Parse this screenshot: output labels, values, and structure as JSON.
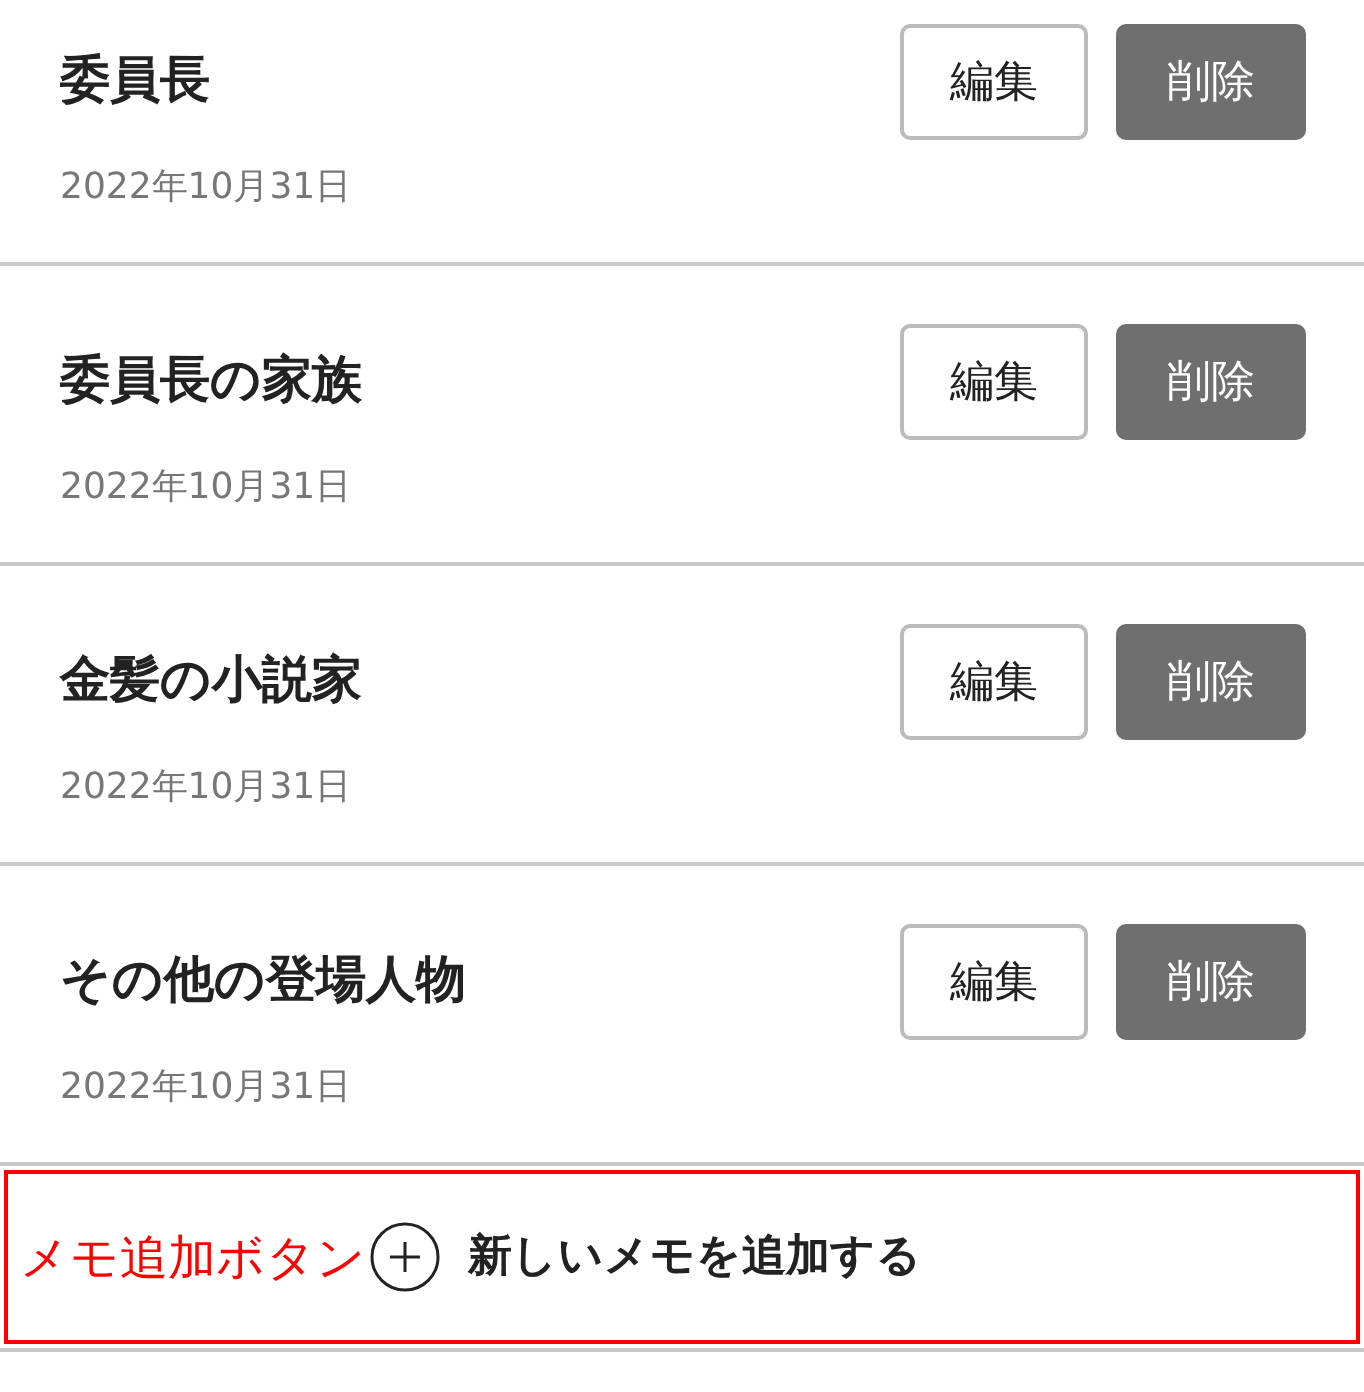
{
  "memos": [
    {
      "title": "委員長",
      "date": "2022年10月31日",
      "edit_label": "編集",
      "delete_label": "削除"
    },
    {
      "title": "委員長の家族",
      "date": "2022年10月31日",
      "edit_label": "編集",
      "delete_label": "削除"
    },
    {
      "title": "金髪の小説家",
      "date": "2022年10月31日",
      "edit_label": "編集",
      "delete_label": "削除"
    },
    {
      "title": "その他の登場人物",
      "date": "2022年10月31日",
      "edit_label": "編集",
      "delete_label": "削除"
    }
  ],
  "add_button": {
    "annotation": "メモ追加ボタン",
    "label": "新しいメモを追加する"
  }
}
